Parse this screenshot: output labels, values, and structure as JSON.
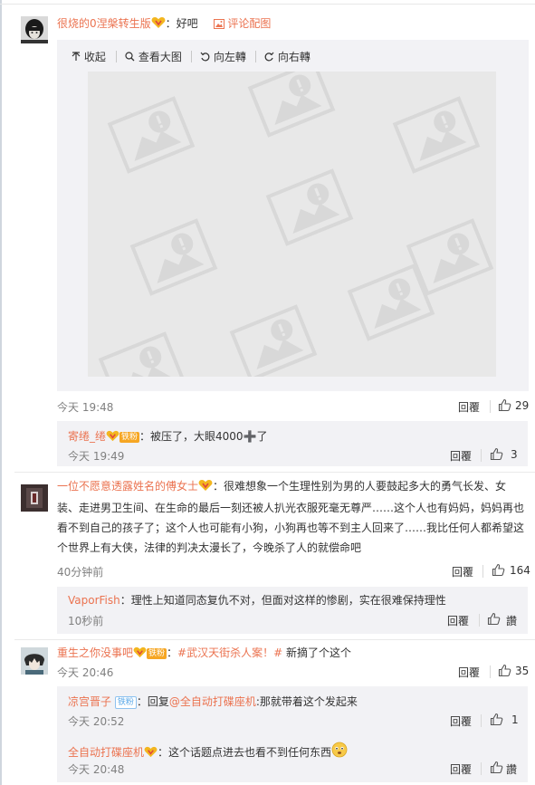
{
  "c1": {
    "user": "很烧的0涅槃转生版",
    "text": "：好吧",
    "pic_link": "评论配图",
    "toolbar": {
      "collapse": "收起",
      "view_large": "查看大图",
      "rotate_left": "向左轉",
      "rotate_right": "向右轉"
    },
    "time": "今天 19:48",
    "reply": "回覆",
    "likes": "29",
    "sub": {
      "user": "寄绻_绻",
      "tag": "铁粉",
      "text": "：被压了，大眼4000➕了",
      "time": "今天 19:49",
      "reply": "回覆",
      "likes": "3"
    }
  },
  "c2": {
    "user": "一位不愿意透露姓名的傅女士",
    "text": "：很难想象一个生理性别为男的人要鼓起多大的勇气长发、女装、走进男卫生间、在生命的最后一刻还被人扒光衣服死毫无尊严……这个人也有妈妈，妈妈再也看不到自己的孩子了；这个人也可能有小狗，小狗再也等不到主人回来了……我比任何人都希望这个世界上有大侠，法律的判决太漫长了，今晚杀了人的就偿命吧",
    "time": "40分钟前",
    "reply": "回覆",
    "likes": "164",
    "sub": {
      "user": "VaporFish",
      "text": "：理性上知道同态复仇不对，但面对这样的惨剧，实在很难保持理性",
      "time": "10秒前",
      "reply": "回覆",
      "likes": "讚"
    }
  },
  "c3": {
    "user": "重生之你没事吧",
    "tag": "铁粉",
    "text_prefix": "：",
    "hashtag": "#武汉天街杀人案！#",
    "text_suffix": " 新摘了个这个",
    "time": "今天 20:46",
    "reply": "回覆",
    "likes": "35",
    "subs": [
      {
        "user": "凉宫晋子",
        "tag": "铁粉",
        "text_prefix": "：回复",
        "mention": "@全自动打碟座机",
        "text_suffix": ":那就带着这个发起来",
        "time": "今天 20:52",
        "reply": "回覆",
        "likes": "1"
      },
      {
        "user": "全自动打碟座机",
        "text": "：这个话题点进去也看不到任何东西",
        "time": "今天 20:48",
        "reply": "回覆",
        "likes": "讚"
      }
    ]
  },
  "colors": {
    "username": "#eb7350",
    "meta": "#808080",
    "subbox": "#f2f2f5"
  }
}
